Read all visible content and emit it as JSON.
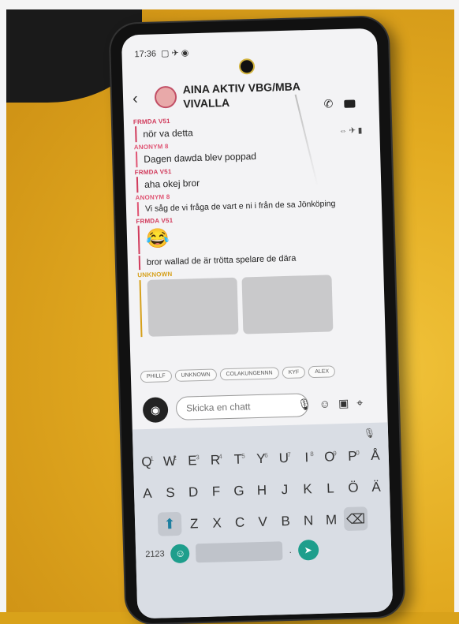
{
  "status_bar": {
    "time": "17:36"
  },
  "header": {
    "title": "AINA AKTIV VBG/MBA VIVALLA"
  },
  "messages": [
    {
      "sender": "FRMDA V51",
      "text": "nör va detta",
      "color": "red"
    },
    {
      "sender": "ANONYM 8",
      "text": "Dagen dawda blev poppad",
      "color": "pink"
    },
    {
      "sender": "FRMDA V51",
      "text": "aha okej bror",
      "color": "red"
    },
    {
      "sender": "ANONYM 8",
      "text": "Vi såg de vi fråga de vart e ni i från de sa Jönköping",
      "color": "pink"
    },
    {
      "sender": "FRMDA V51",
      "text": "😂",
      "color": "red"
    },
    {
      "sender": "",
      "text": "bror wallad de är trötta spelare de dära",
      "color": "red"
    },
    {
      "sender": "UNKNOWN",
      "text": "",
      "color": "gold"
    }
  ],
  "chips": [
    "PHILLF",
    "UNKNOWN",
    "COLAKUNGENNN",
    "KYF",
    "ALEX"
  ],
  "composer": {
    "placeholder": "Skicka en chatt"
  },
  "keyboard": {
    "row1": [
      "Q",
      "W",
      "E",
      "R",
      "T",
      "Y",
      "U",
      "I",
      "O",
      "P",
      "Å"
    ],
    "row1_nums": [
      "1",
      "2",
      "3",
      "4",
      "5",
      "6",
      "7",
      "8",
      "9",
      "0",
      ""
    ],
    "row2": [
      "A",
      "S",
      "D",
      "F",
      "G",
      "H",
      "J",
      "K",
      "L",
      "Ö",
      "Ä"
    ],
    "row3": [
      "Z",
      "X",
      "C",
      "V",
      "B",
      "N",
      "M"
    ],
    "num_label": "2123"
  }
}
